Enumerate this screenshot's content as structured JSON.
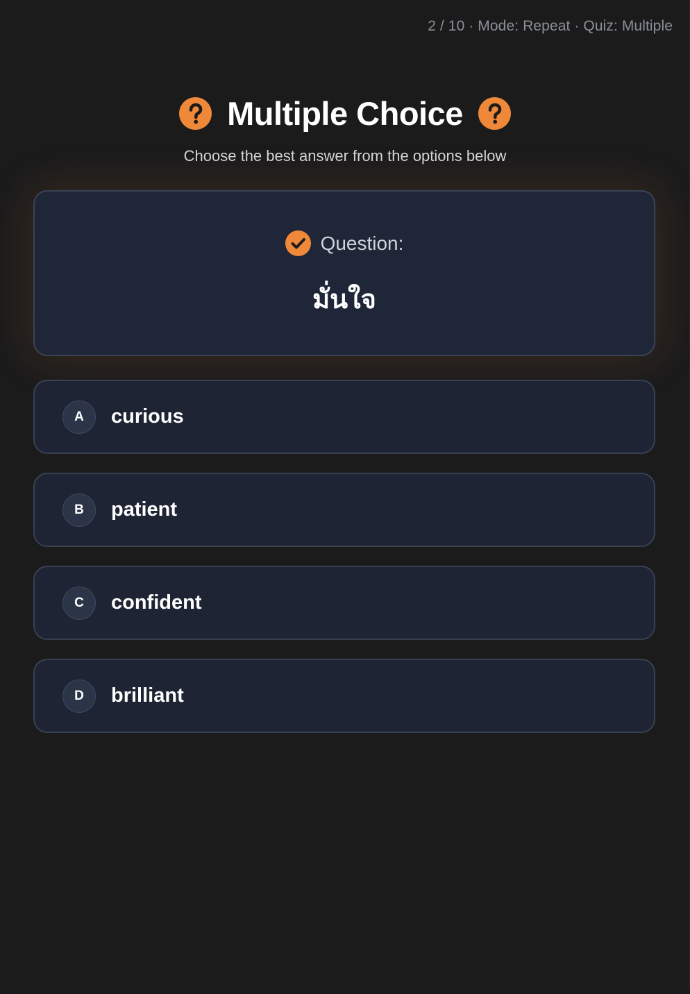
{
  "header": {
    "progress_text": "2 / 10 · Mode: Repeat · Quiz: Multiple"
  },
  "title": {
    "text": "Multiple Choice",
    "subtitle": "Choose the best answer from the options below",
    "icon": "question-circle-icon"
  },
  "question": {
    "label": "Question:",
    "word": "มั่นใจ",
    "icon": "check-circle-icon"
  },
  "options": [
    {
      "letter": "A",
      "text": "curious"
    },
    {
      "letter": "B",
      "text": "patient"
    },
    {
      "letter": "C",
      "text": "confident"
    },
    {
      "letter": "D",
      "text": "brilliant"
    }
  ],
  "colors": {
    "accent": "#f0883a",
    "background": "#1b1b1c",
    "card": "#1e2638",
    "card_border": "#3a4354"
  }
}
